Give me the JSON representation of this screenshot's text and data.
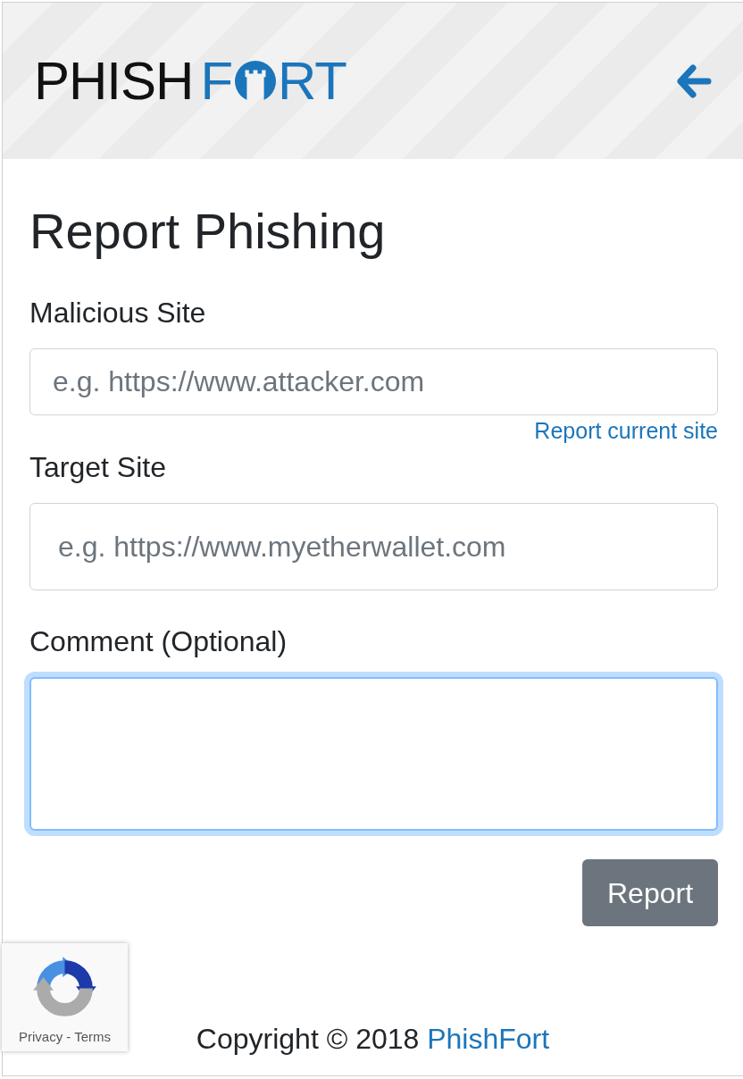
{
  "header": {
    "logo": {
      "dark_text": "PHISH",
      "accent_text_before": "F",
      "accent_text_after": "RT"
    }
  },
  "form": {
    "title": "Report Phishing",
    "fields": [
      {
        "kind": "input",
        "label": "Malicious Site",
        "placeholder": "e.g. https://www.attacker.com",
        "link": "Report current site",
        "focused": false
      },
      {
        "kind": "input",
        "label": "Target Site",
        "placeholder": "e.g. https://www.myetherwallet.com",
        "focused": false
      },
      {
        "kind": "textarea",
        "label": "Comment (Optional)",
        "focused": true
      }
    ],
    "submit_button": "Report"
  },
  "recaptcha_badge": {
    "links": "Privacy - Terms"
  },
  "footer": {
    "text": "Copyright © 2018",
    "link": "PhishFort"
  }
}
